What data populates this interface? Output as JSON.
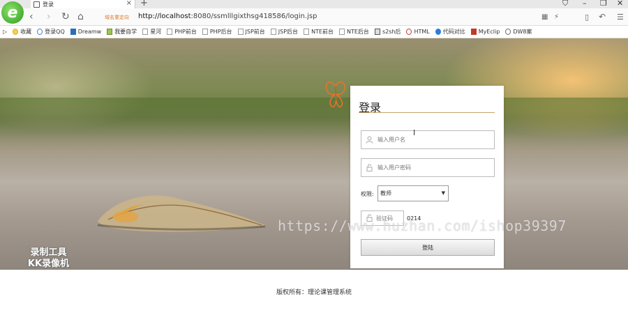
{
  "browser": {
    "tab_title": "登录",
    "tab_close": "×",
    "new_tab": "+",
    "logo": "e",
    "domain_tag": "域名重定向",
    "url_host": "http://localhost",
    "url_rest": ":8080/ssmlllgixthsg418586/login.jsp",
    "bookmarks": [
      {
        "label": "收藏",
        "icon": "star-icon",
        "color": "#e6a817"
      },
      {
        "label": "登录QQ",
        "icon": "qq-icon",
        "color": "#3b7dd8"
      },
      {
        "label": "Dreamw",
        "icon": "dreamweaver-icon",
        "color": "#2a6ebb"
      },
      {
        "label": "我要自学",
        "icon": "book-icon",
        "color": "#6a8f2a"
      },
      {
        "label": "星河",
        "icon": "page-icon",
        "color": "#999999"
      },
      {
        "label": "PHP前台",
        "icon": "page-icon",
        "color": "#999999"
      },
      {
        "label": "PHP后台",
        "icon": "page-icon",
        "color": "#999999"
      },
      {
        "label": "JSP前台",
        "icon": "page-icon",
        "color": "#999999"
      },
      {
        "label": "JSP后台",
        "icon": "page-icon",
        "color": "#999999"
      },
      {
        "label": "NTE前台",
        "icon": "page-icon",
        "color": "#999999"
      },
      {
        "label": "NTE后台",
        "icon": "page-icon",
        "color": "#999999"
      },
      {
        "label": "s2sh后",
        "icon": "page-icon",
        "color": "#555555"
      },
      {
        "label": "HTML",
        "icon": "html-icon",
        "color": "#c0392b"
      },
      {
        "label": "代码对比",
        "icon": "compare-icon",
        "color": "#2a7dd8"
      },
      {
        "label": "MyEclip",
        "icon": "myeclipse-icon",
        "color": "#c0392b"
      },
      {
        "label": "DW8案",
        "icon": "gear-icon",
        "color": "#666666"
      }
    ]
  },
  "page": {
    "panel_title": "登录",
    "username_placeholder": "输入用户名",
    "password_placeholder": "输入用户密码",
    "role_label": "权限:",
    "role_selected": "教师",
    "captcha_placeholder": "验证码",
    "captcha_code": "0214",
    "login_button": "登陆",
    "footer": "版权所有：理论课管理系统"
  },
  "overlays": {
    "recorder_line1": "录制工具",
    "recorder_line2": "KK录像机",
    "watermark_url": "https://www.huzhan.com/ishop39397"
  },
  "colors": {
    "accent_line": "#c8a36a",
    "domain_tag": "#e07b2a",
    "butterfly": "#e8742a"
  }
}
